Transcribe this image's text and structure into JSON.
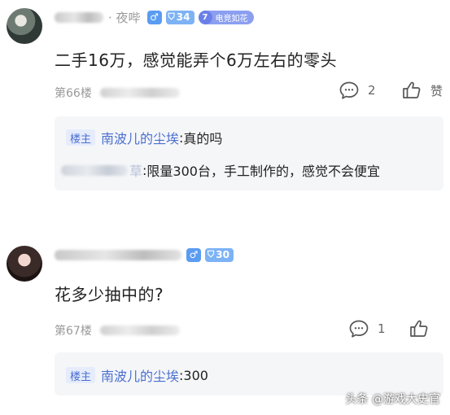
{
  "posts": [
    {
      "user_name_visible": "· 夜哔",
      "gender_icon": "male-icon",
      "level": "34",
      "club_level": "7",
      "club_name": "电竞如花",
      "content": "二手16万，感觉能弄个6万左右的零头",
      "floor": "第66楼",
      "comment_count": "2",
      "like_label": "赞",
      "replies": [
        {
          "host_tag": "楼主",
          "name": "南波儿的尘埃",
          "separator": ": ",
          "text": "真的吗"
        },
        {
          "name_partial": "草",
          "separator": ": ",
          "text": "限量300台，手工制作的，感觉不会便宜"
        }
      ]
    },
    {
      "gender_icon": "male-icon",
      "level": "30",
      "content": "花多少抽中的?",
      "floor": "第67楼",
      "comment_count": "1",
      "replies": [
        {
          "host_tag": "楼主",
          "name": "南波儿的尘埃",
          "separator": ": ",
          "text": "300"
        }
      ]
    }
  ],
  "watermark": "头条 @游戏大史官",
  "colors": {
    "link_blue": "#4a6fd1",
    "gender_blue": "#5a9cf2",
    "reply_bg": "#f5f6f8",
    "meta_gray": "#999999"
  }
}
